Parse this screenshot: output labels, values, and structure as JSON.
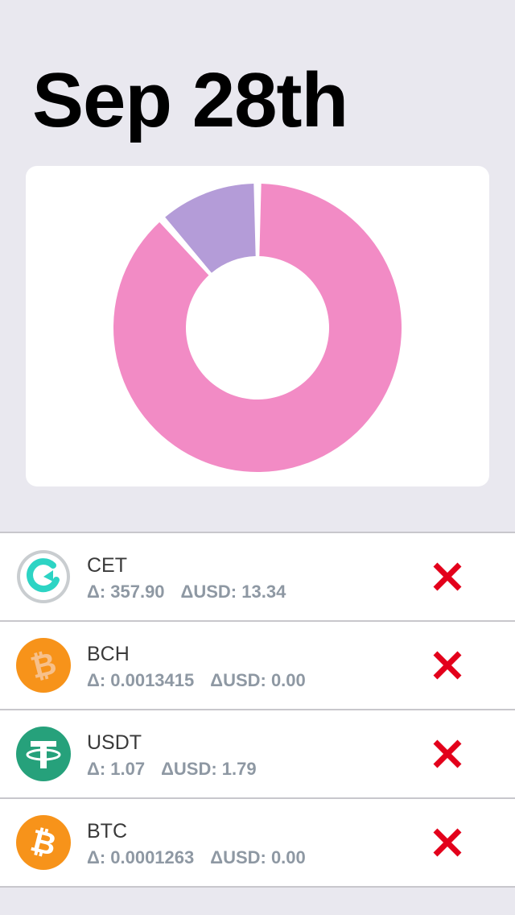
{
  "header": {
    "title": "Sep 28th"
  },
  "chart_data": {
    "type": "pie",
    "donut": true,
    "values": [
      0.885,
      0.115
    ],
    "colors": [
      "#f28bc5",
      "#b49cd8"
    ]
  },
  "coins": [
    {
      "symbol": "CET",
      "delta": "Δ: 357.90",
      "delta_usd": "ΔUSD: 13.34",
      "icon": "coinex-icon",
      "color": "#2dd4c4"
    },
    {
      "symbol": "BCH",
      "delta": "Δ: 0.0013415",
      "delta_usd": "ΔUSD: 0.00",
      "icon": "bitcoin-cash-icon",
      "color": "#f7931a"
    },
    {
      "symbol": "USDT",
      "delta": "Δ: 1.07",
      "delta_usd": "ΔUSD: 1.79",
      "icon": "tether-icon",
      "color": "#26a17b"
    },
    {
      "symbol": "BTC",
      "delta": "Δ: 0.0001263",
      "delta_usd": "ΔUSD: 0.00",
      "icon": "bitcoin-icon",
      "color": "#f7931a"
    }
  ],
  "remove_icon_color": "#e3001b"
}
